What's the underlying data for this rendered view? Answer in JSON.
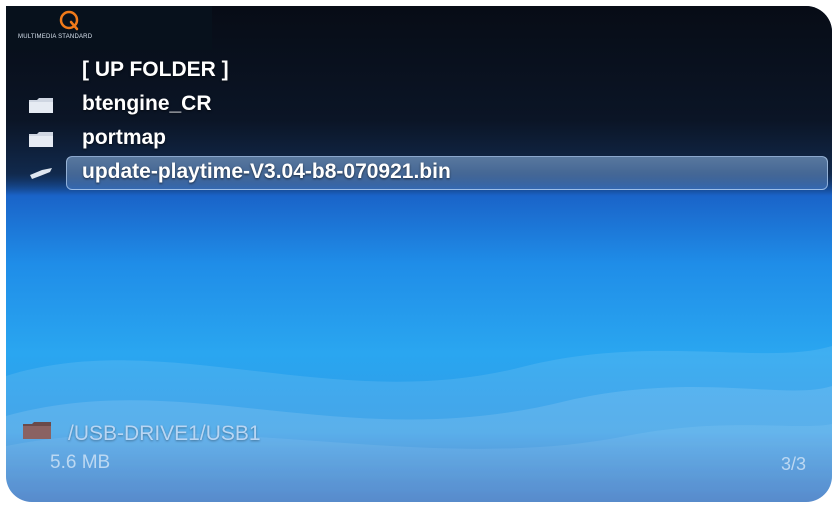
{
  "branding": {
    "logo_text": "MULTIMEDIA STANDARD",
    "logo_icon": "q-logo-icon"
  },
  "file_list": {
    "items": [
      {
        "label": "[ UP FOLDER ]",
        "icon": "none",
        "selected": false
      },
      {
        "label": "btengine_CR",
        "icon": "folder-icon",
        "selected": false
      },
      {
        "label": "portmap",
        "icon": "folder-icon",
        "selected": false
      },
      {
        "label": "update-playtime-V3.04-b8-070921.bin",
        "icon": "file-pointer-icon",
        "selected": true
      }
    ]
  },
  "status": {
    "path_icon": "folder-icon",
    "path": "/USB-DRIVE1/USB1",
    "size": "5.6 MB",
    "page": "3/3"
  },
  "colors": {
    "background_top": "#0b1526",
    "background_bottom": "#1f8de8",
    "selection": "#8fb7e6",
    "text": "#ffffff",
    "status_text": "#b9d6f4"
  }
}
